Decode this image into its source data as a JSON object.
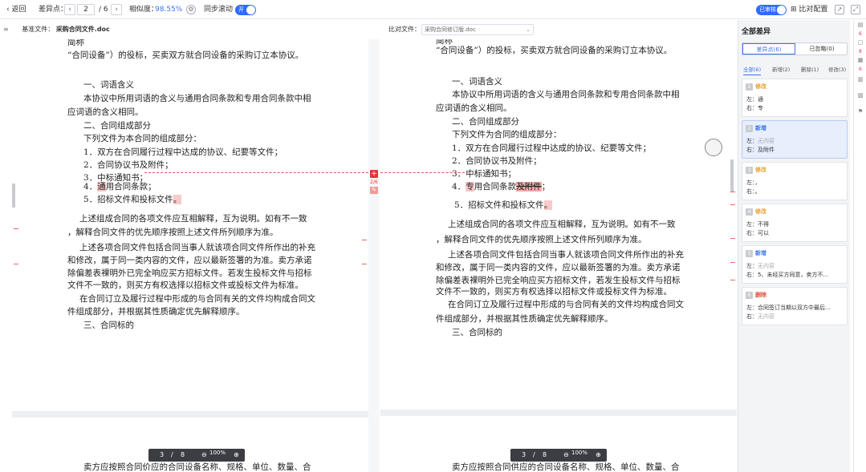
{
  "toolbar": {
    "back_label": "返回",
    "diff_label": "差异点：",
    "prev": "‹",
    "current_page": "2",
    "page_sep": "/ 6",
    "next": "›",
    "similarity_label": "相似度：",
    "similarity_value": "98.55%",
    "sync_scroll_label": "同步滚动",
    "sync_toggle": "开",
    "review_toggle": "已审核",
    "compare_config": "比对配置",
    "export_icon": "export-icon",
    "fullscreen_icon": "fullscreen-icon"
  },
  "left": {
    "header_label": "基准文件：",
    "file_name": "采购合同文件.doc",
    "lines": [
      "简称",
      "“合同设备”）的役标，买卖双方就合同设备的采购订立本协议。",
      "一、词语含义",
      "本协议中所用词语的含义与通用合同条款和专用合同条款中相",
      "应词语的含义相同。",
      "二、合同组成部分",
      "下列文件为本合同的组成部分：",
      "1．双方在合同履行过程中达成的协议、纪要等文件；",
      "2．合同协议书及附件；",
      "3．中标通知书；",
      "4．",
      "通",
      "用合同条款；",
      "5．招标文件和投标文件",
      "。",
      "上述组成合同的各项文件应互相解释，互为说明。如有不一致",
      "，解释合同文件的优先顺序按照上述文件所列顺序为准。",
      "上述各项合同文件包括合同当事人就该项合同文件所作出的补充",
      "和修改，属于同一类内容的文件，应以最新签署的为准。卖方承诺",
      "除偏差表裸明外已完全响应买方招标文件。若发生投标文件与招标",
      "文件不一致的，则买方有权选择以招标文件或投标文件为标准。",
      "在合同订立及履行过程中形成的与合同有关的文件均构成合同文",
      "件组成部分，并根据其性质确定优先解释顺序。",
      "三、合同标的",
      "卖方应按照合同价应的合同设备名称、规格、单位、数量、合"
    ],
    "pager_current": "3",
    "pager_sep": "/",
    "pager_total": "8",
    "zoom": "100%"
  },
  "right": {
    "header_label": "比对文件：",
    "file_name": "采购合同修订版.doc",
    "lines": [
      "简称",
      "“合同设备”）的投标，买卖双方就合同设备的采购订立本协议。",
      "一、词语含义",
      "本协议中所用词语的含义与通用合同条款和专用合同条款中相",
      "应词语的含义相同。",
      "二、合同组成部分",
      "下列文件为合同的组成部分：",
      "1．双方在合同履行过程中达成的协议、纪要等文件；",
      "2．合同协议书及附件；",
      "3．中标通知书；",
      "4．",
      "专",
      "用合同条款",
      "及附件",
      "；",
      "5．招标文件和投标文件",
      "。",
      "上述组成合同的各项文件应互相解释，互为说明。如有不一致",
      "，解释合同文件的优先顺序按照上述文件所列顺序为准。",
      "上述各项合同文件包括合同当事人就该项合同文件所作出的补充",
      "和修改，属于同一类内容的文件，应以最新签署的为准。卖方承诺",
      "除偏差表裸明外已完全响应买方招标文件，若发生投标文件与招标",
      "文件不一致的，则买方有权选择以招标文件或投标文件为标准。",
      "在合同订立及履行过程中形成的与合同有关的文件均构成合同文",
      "件组成部分，并根据其性质确定优先解释顺序。",
      "三、合同标的",
      "卖方应按照合同供应的合同设备名称、规格、单位、数量、合"
    ],
    "pager_current": "3",
    "pager_sep": "/",
    "pager_total": "8",
    "zoom": "100%"
  },
  "panel": {
    "title": "全部差异",
    "seg_diff": "差异点(6)",
    "seg_ignored": "已忽略(0)",
    "tabs": [
      "全部(6)",
      "新增(2)",
      "删除(1)",
      "修改(3)"
    ],
    "left_label": "左：",
    "right_label": "右：",
    "cards": [
      {
        "num": "1",
        "type": "修改",
        "left": "通",
        "right": "专"
      },
      {
        "num": "2",
        "type": "新增",
        "left": "无内容",
        "right": "及附件"
      },
      {
        "num": "3",
        "type": "修改",
        "left": "，",
        "right": "。"
      },
      {
        "num": "4",
        "type": "修改",
        "left": "不得",
        "right": "可以"
      },
      {
        "num": "5",
        "type": "新增",
        "left": "无内容",
        "right": "5、未经买方同意，卖方不..."
      },
      {
        "num": "6",
        "type": "删除",
        "left": "合同签订当期以双方中最后...",
        "right": "无内容"
      }
    ]
  },
  "strip": {
    "badges": [
      "6",
      "8",
      "6"
    ]
  },
  "colors": {
    "accent": "#2f6bff",
    "modify": "#e8a02c",
    "add": "#3b74e8",
    "delete": "#e0513c",
    "highlight": "#f8c9c9"
  }
}
